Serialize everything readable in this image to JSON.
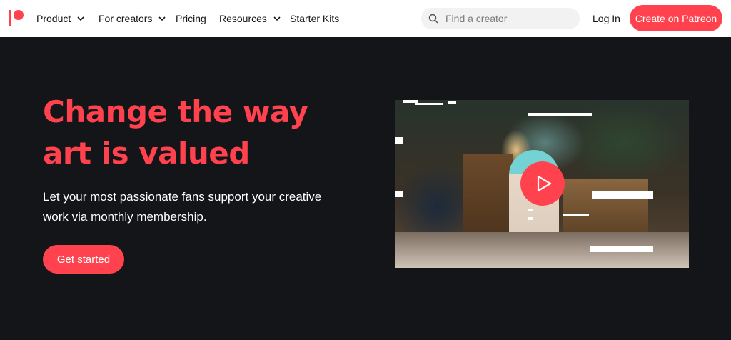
{
  "nav": {
    "items": [
      {
        "label": "Product",
        "has_dropdown": true
      },
      {
        "label": "For creators",
        "has_dropdown": true
      },
      {
        "label": "Pricing",
        "has_dropdown": false
      },
      {
        "label": "Resources",
        "has_dropdown": true
      },
      {
        "label": "Starter Kits",
        "has_dropdown": false
      }
    ],
    "search_placeholder": "Find a creator",
    "login_label": "Log In",
    "cta_label": "Create on Patreon"
  },
  "hero": {
    "headline_line1": "Change the way",
    "headline_line2": "art is valued",
    "subtext_line1": "Let your most passionate fans support your creative",
    "subtext_line2": "work via monthly membership.",
    "cta_label": "Get started"
  },
  "video": {
    "play_icon": "play-icon"
  },
  "colors": {
    "brand": "#ff424d",
    "background": "#141518",
    "nav_background": "#ffffff"
  }
}
